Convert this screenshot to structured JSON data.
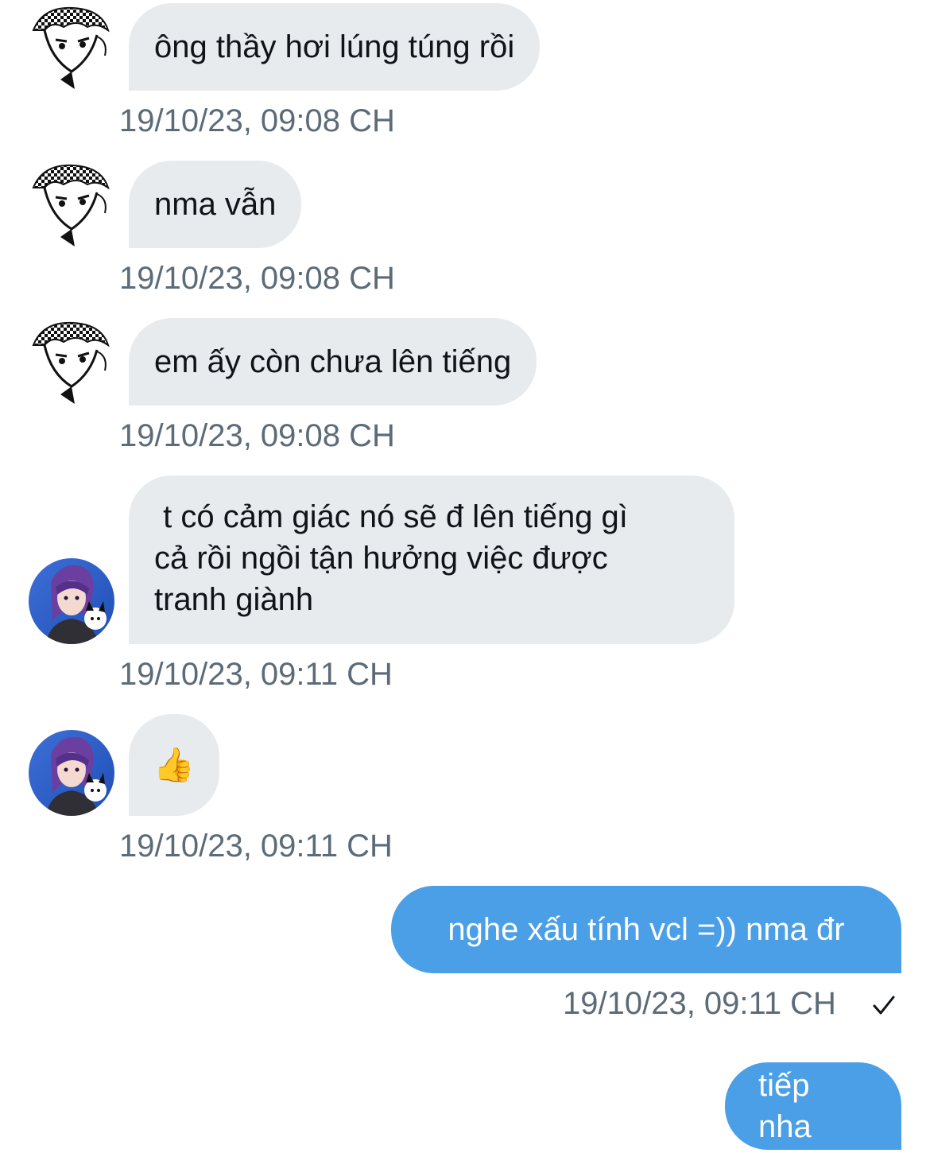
{
  "messages": [
    {
      "direction": "incoming",
      "sender_avatar": "avatar-manga-boy",
      "text": "ông thầy hơi lúng túng rồi",
      "timestamp": "19/10/23, 09:08 CH"
    },
    {
      "direction": "incoming",
      "sender_avatar": "avatar-manga-boy",
      "text": "nma vẫn",
      "timestamp": "19/10/23, 09:08 CH"
    },
    {
      "direction": "incoming",
      "sender_avatar": "avatar-manga-boy",
      "text": "em ấy còn chưa lên tiếng",
      "timestamp": "19/10/23, 09:08 CH"
    },
    {
      "direction": "incoming",
      "sender_avatar": "avatar-purple-hair",
      "text": " t có cảm giác nó sẽ đ lên tiếng gì\ncả rồi ngồi tận hưởng việc được\ntranh giành",
      "timestamp": "19/10/23, 09:11 CH"
    },
    {
      "direction": "incoming",
      "sender_avatar": "avatar-purple-hair",
      "text": "👍",
      "icon": "thumbs-up-icon",
      "timestamp": "19/10/23, 09:11 CH"
    },
    {
      "direction": "outgoing",
      "text": "nghe xấu tính vcl =)) nma đr",
      "timestamp": "19/10/23, 09:11 CH",
      "status_icon": "checkmark-icon"
    },
    {
      "direction": "outgoing",
      "text": "tiếp nha"
    }
  ],
  "colors": {
    "incoming_bubble": "#e7ebee",
    "outgoing_bubble": "#4a9fe6",
    "timestamp_text": "#5c6b78",
    "message_text": "#0f1419"
  }
}
